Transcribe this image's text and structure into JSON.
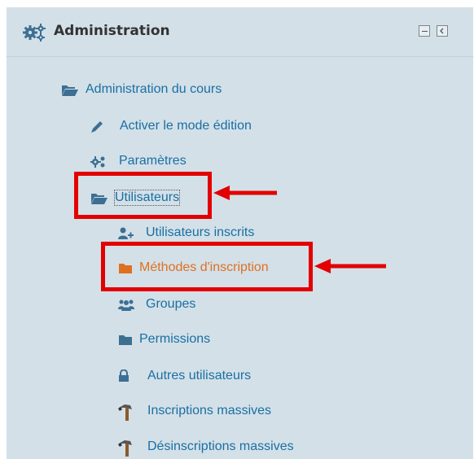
{
  "block": {
    "title": "Administration",
    "header_buttons": [
      "minimize",
      "dock"
    ]
  },
  "tree": {
    "root": {
      "label": "Administration du cours",
      "icon": "folder-open-icon"
    },
    "items": [
      {
        "label": "Activer le mode édition",
        "icon": "pencil-icon"
      },
      {
        "label": "Paramètres",
        "icon": "gear-icon"
      },
      {
        "label": "Utilisateurs",
        "icon": "folder-open-icon",
        "highlighted": true
      },
      {
        "label": "Utilisateurs inscrits",
        "icon": "add-user-icon"
      },
      {
        "label": "Méthodes d'inscription",
        "icon": "folder-icon",
        "highlighted": true,
        "color": "#e07020"
      },
      {
        "label": "Groupes",
        "icon": "users-icon"
      },
      {
        "label": "Permissions",
        "icon": "folder-icon"
      },
      {
        "label": "Autres utilisateurs",
        "icon": "lock-icon"
      },
      {
        "label": "Inscriptions massives",
        "icon": "hammer-icon"
      },
      {
        "label": "Désinscriptions massives",
        "icon": "hammer-icon"
      }
    ]
  },
  "colors": {
    "link": "#1a6fa3",
    "active": "#e07020",
    "highlight": "#e30000",
    "background": "#d3e0e8"
  }
}
